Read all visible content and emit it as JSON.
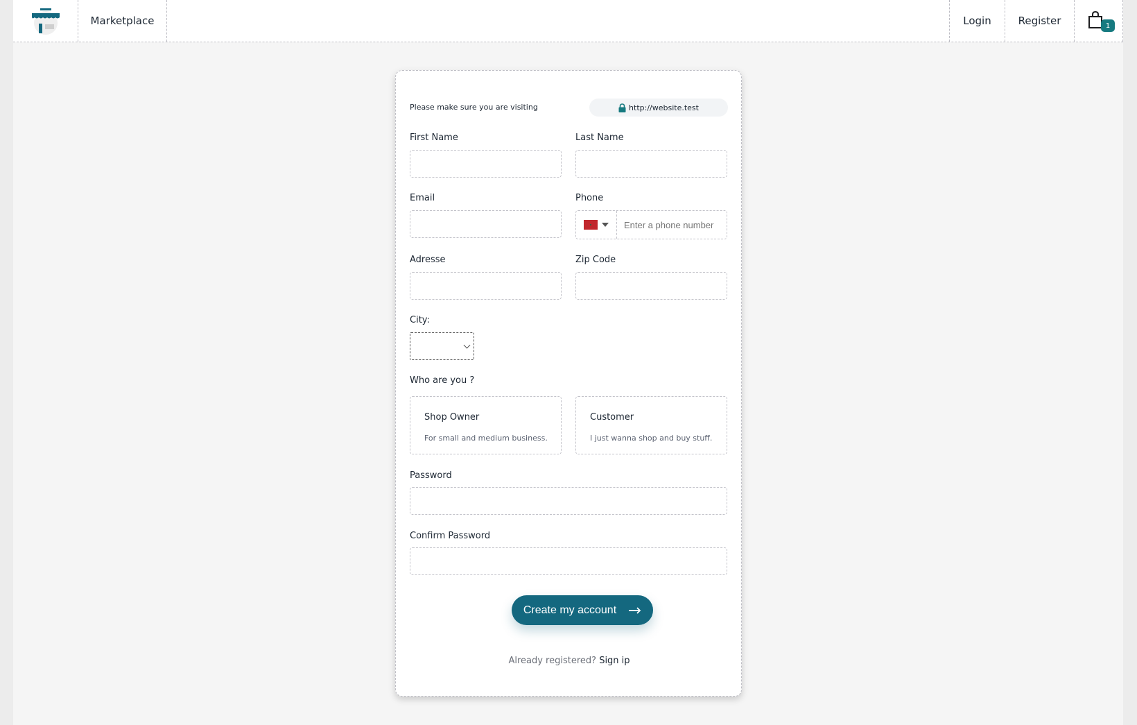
{
  "header": {
    "brand": "Marketplace",
    "nav": {
      "login": "Login",
      "register": "Register"
    },
    "cart": {
      "icon": "shopping-bag-icon",
      "count": "1"
    },
    "logo_icon": "storefront-icon"
  },
  "form": {
    "notice": "Please make sure you are visiting",
    "url": "http://website.test",
    "url_icon": "lock-icon",
    "fields": {
      "first_name": {
        "label": "First Name",
        "value": ""
      },
      "last_name": {
        "label": "Last Name",
        "value": ""
      },
      "email": {
        "label": "Email",
        "value": ""
      },
      "phone": {
        "label": "Phone",
        "placeholder": "Enter a phone number",
        "country_flag": "flag-morocco"
      },
      "address": {
        "label": "Adresse",
        "value": ""
      },
      "zip": {
        "label": "Zip Code",
        "value": ""
      },
      "city": {
        "label": "City:",
        "selected": ""
      },
      "password": {
        "label": "Password",
        "value": ""
      },
      "confirm_password": {
        "label": "Confirm Password",
        "value": ""
      }
    },
    "role": {
      "label": "Who are you ?",
      "options": [
        {
          "title": "Shop Owner",
          "description": "For small and medium business."
        },
        {
          "title": "Customer",
          "description": "I just wanna shop and buy stuff."
        }
      ]
    },
    "submit": {
      "label": "Create my account",
      "icon": "arrow-right-icon"
    },
    "footer": {
      "text": "Already registered?",
      "link": "Sign ip"
    }
  },
  "colors": {
    "accent": "#14687f",
    "badge": "#167a80",
    "flag": "#c1272d"
  }
}
